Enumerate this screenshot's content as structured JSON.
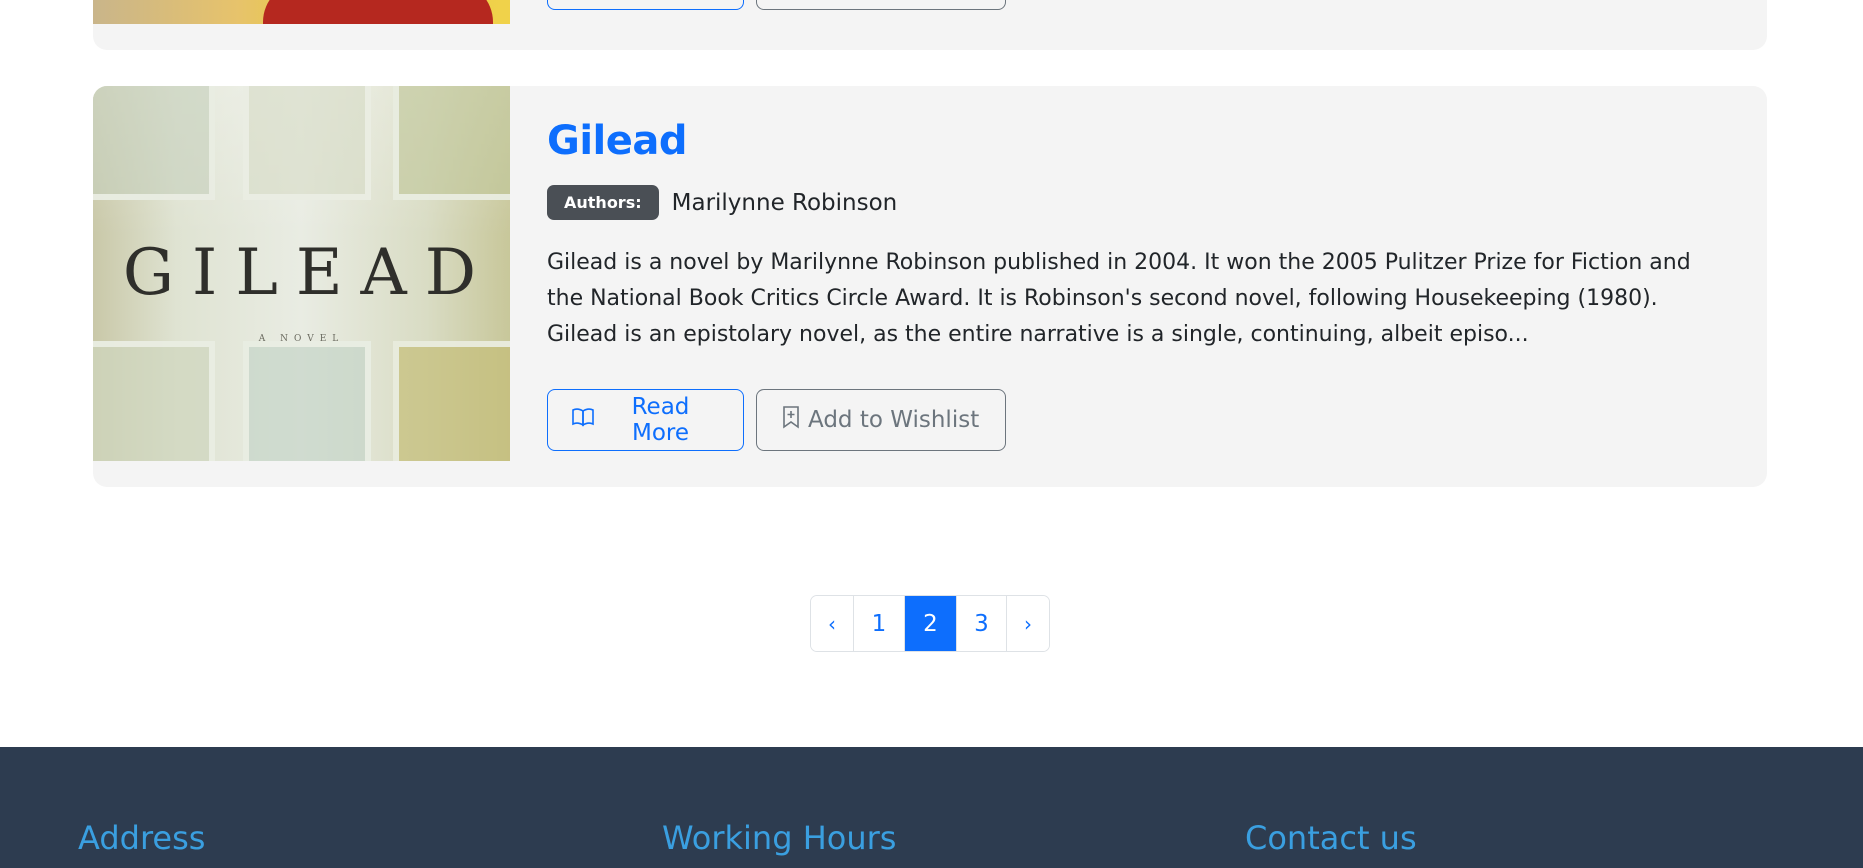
{
  "book": {
    "title": "Gilead",
    "authors_label": "Authors:",
    "authors": "Marilynne Robinson",
    "description": "Gilead is a novel by Marilynne Robinson published in 2004. It won the 2005 Pulitzer Prize for Fiction and the National Book Critics Circle Award. It is Robinson's second novel, following Housekeeping (1980). Gilead is an epistolary novel, as the entire narrative is a single, continuing, albeit episo...",
    "cover_title": "GILEAD",
    "cover_subtitle": "A NOVEL",
    "read_more_label": "Read More",
    "wishlist_label": "Add to Wishlist",
    "read_more_icon": "book-open-icon",
    "wishlist_icon": "bookmark-plus-icon"
  },
  "pagination": {
    "prev": "‹",
    "pages": [
      "1",
      "2",
      "3"
    ],
    "current": "2",
    "next": "›"
  },
  "footer": {
    "address_heading": "Address",
    "hours_heading": "Working Hours",
    "contact_heading": "Contact us"
  },
  "colors": {
    "primary": "#0d6efd",
    "secondary": "#6c757d",
    "footer_bg": "#2d3c50",
    "footer_heading": "#3a9fe0",
    "badge_bg": "#4a4f55"
  }
}
